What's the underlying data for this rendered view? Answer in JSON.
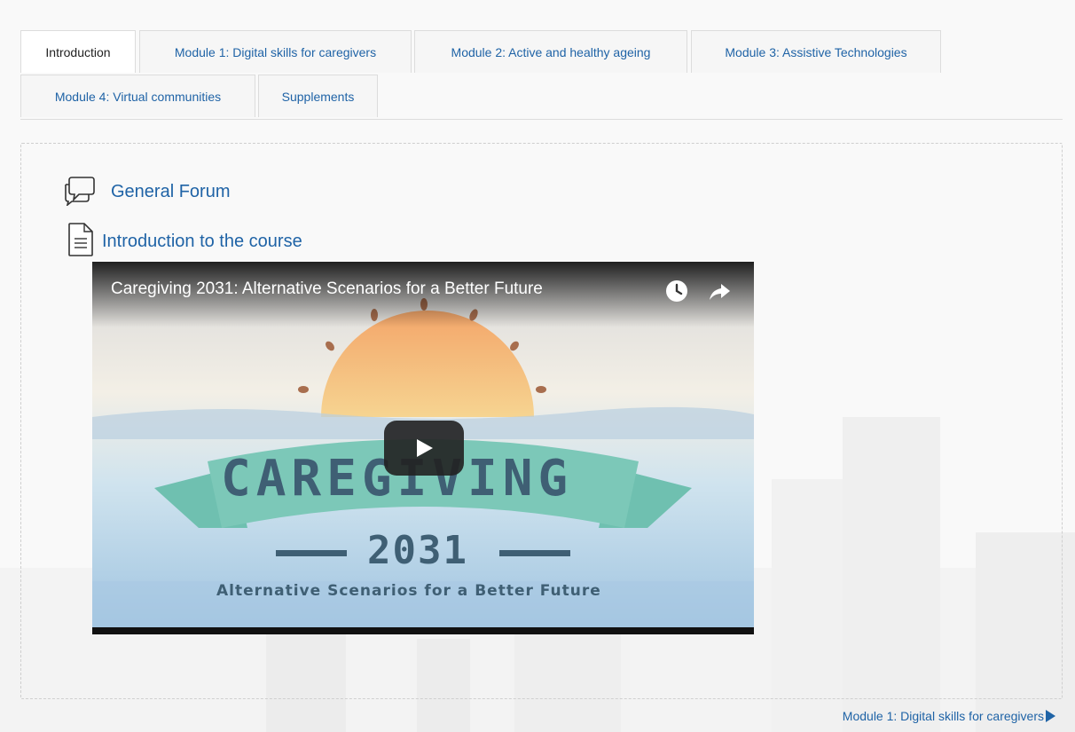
{
  "tabs": [
    {
      "label": "Introduction",
      "active": true
    },
    {
      "label": "Module 1: Digital skills for caregivers",
      "active": false
    },
    {
      "label": "Module 2: Active and healthy ageing",
      "active": false
    },
    {
      "label": "Module 3: Assistive Technologies",
      "active": false
    },
    {
      "label": "Module 4: Virtual communities",
      "active": false
    },
    {
      "label": "Supplements",
      "active": false
    }
  ],
  "activities": [
    {
      "label": "General Forum",
      "icon": "forum-icon"
    },
    {
      "label": "Introduction to the course",
      "icon": "page-icon"
    }
  ],
  "video": {
    "title": "Caregiving 2031: Alternative Scenarios for a Better Future",
    "thumbnail_word": "CAREGIVING",
    "thumbnail_year": "2031",
    "thumbnail_subtitle": "Alternative Scenarios for a Better Future",
    "icons": [
      "watch-later-icon",
      "share-icon",
      "play-icon"
    ]
  },
  "navigation": {
    "next_label": "Module 1: Digital skills for caregivers"
  },
  "colors": {
    "link": "#1f63a6",
    "active_tab_text": "#222222",
    "banner": "#7cc8b8",
    "sun": "#f0a56b"
  }
}
